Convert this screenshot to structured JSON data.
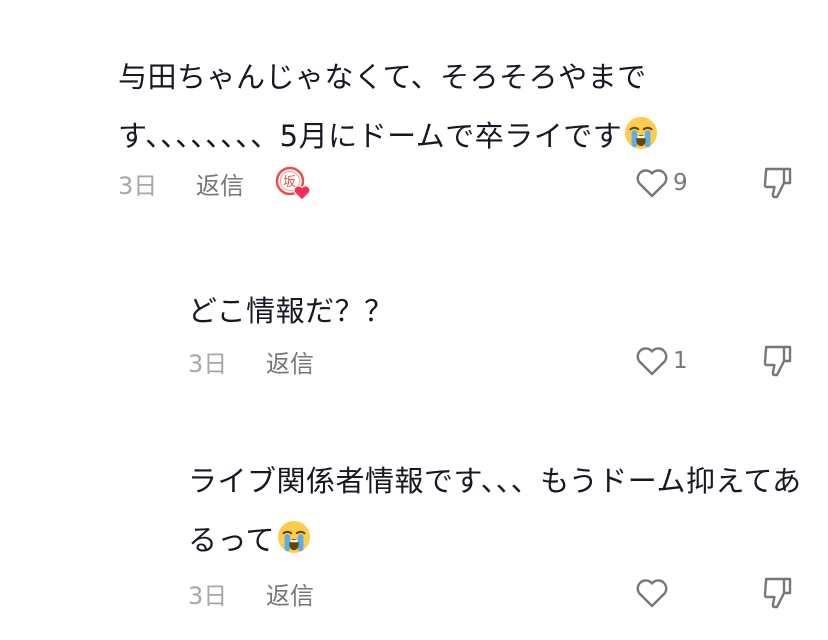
{
  "comments": [
    {
      "text": "与田ちゃんじゃなくて、そろそろやまです、、、、、、、、5月にドームで卒ライです",
      "emoji": "crying-face",
      "time": "3日",
      "reply_label": "返信",
      "creator_liked_badge": true,
      "like_count": "9"
    },
    {
      "text": "どこ情報だ？？",
      "time": "3日",
      "reply_label": "返信",
      "like_count": "1"
    },
    {
      "text": "ライブ関係者情報です、、、もうドーム抑えてあるって",
      "emoji": "crying-face",
      "time": "3日",
      "reply_label": "返信",
      "like_count": ""
    }
  ],
  "badge": {
    "kanji": "坂",
    "ring_color": "#e8514f",
    "heart_color": "#fe2c55"
  },
  "colors": {
    "text": "#161823",
    "meta": "#a6a7ab",
    "icon": "#76777b"
  }
}
